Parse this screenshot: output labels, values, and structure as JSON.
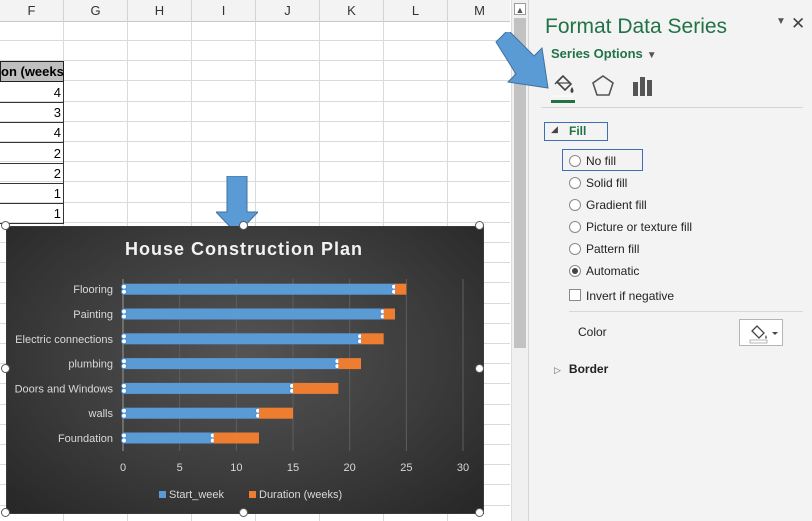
{
  "spreadsheet": {
    "columns": [
      "F",
      "G",
      "H",
      "I",
      "J",
      "K",
      "L",
      "M"
    ],
    "header_cell": "on (weeks)",
    "values": [
      "4",
      "3",
      "4",
      "2",
      "2",
      "1",
      "1"
    ]
  },
  "chart_data": {
    "type": "bar",
    "orientation": "horizontal",
    "stacked": true,
    "title": "House Construction Plan",
    "categories": [
      "Foundation",
      "walls",
      "Doors and Windows",
      "plumbing",
      "Electric connections",
      "Painting",
      "Flooring"
    ],
    "series": [
      {
        "name": "Start_week",
        "color": "#5b9bd5",
        "values": [
          8,
          12,
          15,
          19,
          21,
          23,
          24
        ]
      },
      {
        "name": "Duration (weeks)",
        "color": "#ed7d31",
        "values": [
          4,
          3,
          4,
          2,
          2,
          1,
          1
        ]
      }
    ],
    "xlim": [
      0,
      30
    ],
    "xticks": [
      "0",
      "5",
      "10",
      "15",
      "20",
      "25",
      "30"
    ],
    "grid": true,
    "legend": "bottom",
    "selected_series": "Start_week"
  },
  "pane": {
    "title": "Format Data Series",
    "series_options": "Series Options",
    "tabs": [
      "fill-line-icon",
      "effects-icon",
      "series-options-icon"
    ],
    "fill_section": "Fill",
    "fill_options": [
      {
        "label": "No fill",
        "selected": false
      },
      {
        "label": "Solid fill",
        "selected": false
      },
      {
        "label": "Gradient fill",
        "selected": false
      },
      {
        "label": "Picture or texture fill",
        "selected": false
      },
      {
        "label": "Pattern fill",
        "selected": false
      },
      {
        "label": "Automatic",
        "selected": true
      }
    ],
    "invert_label": "Invert if negative",
    "color_label": "Color",
    "border_section": "Border"
  },
  "colors": {
    "accent": "#217346",
    "annotation_arrow": "#5b9bd5"
  }
}
